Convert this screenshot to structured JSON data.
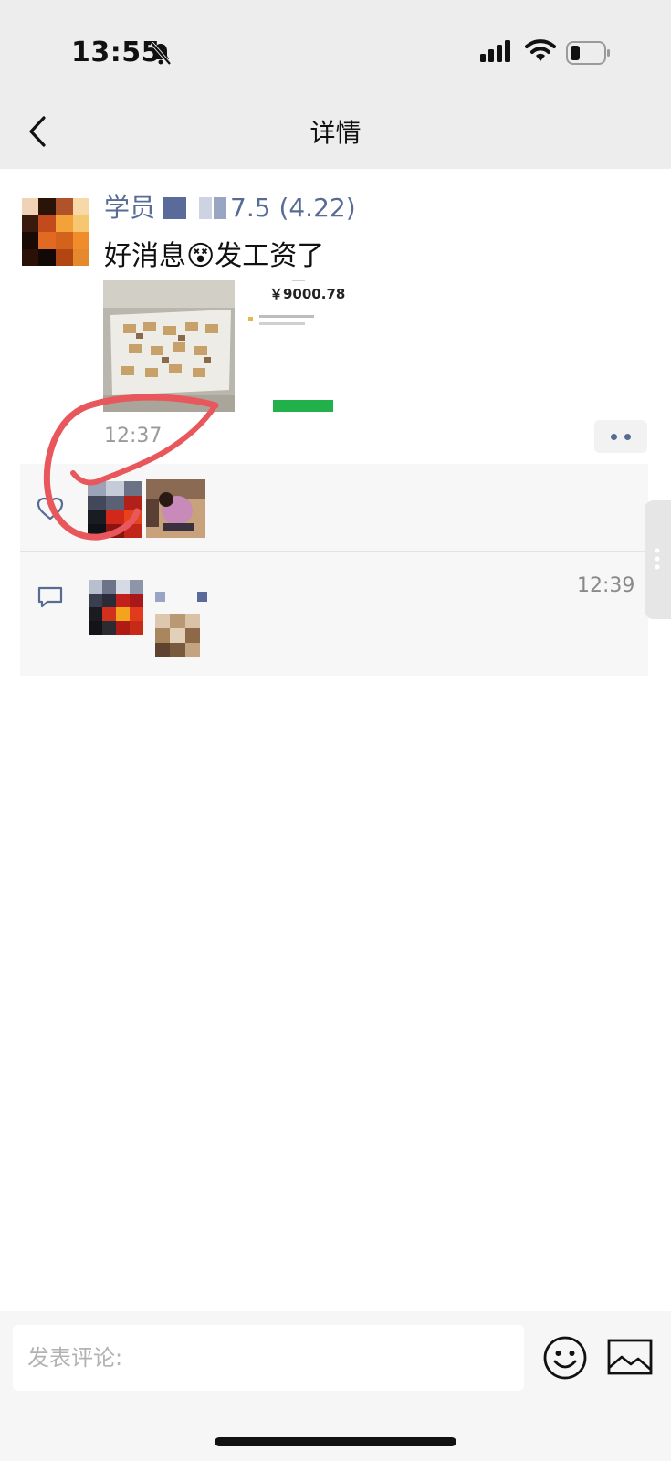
{
  "status_bar": {
    "time": "13:55",
    "icons": [
      "bell-muted-icon",
      "signal-icon",
      "wifi-icon",
      "battery-icon"
    ]
  },
  "nav": {
    "title": "详情",
    "back_icon": "back-chevron-icon"
  },
  "post": {
    "author": "学员",
    "author_suffix": "7.5 (4.22)",
    "text_before": "好消息",
    "emoji": "😵",
    "text_after": "发工资了",
    "images": [
      {
        "name": "photo-cash",
        "description_icon": "cash-photo"
      },
      {
        "name": "photo-payment-screenshot",
        "amount": "￥9000.78"
      }
    ],
    "time": "12:37"
  },
  "likes": {
    "icon": "heart-icon",
    "avatars": [
      "avatar-like-1",
      "avatar-like-2"
    ]
  },
  "comments": [
    {
      "icon": "comment-icon",
      "time": "12:39"
    }
  ],
  "composer": {
    "placeholder": "发表评论:",
    "emoji_icon": "emoji-icon",
    "image_icon": "image-icon"
  },
  "colors": {
    "link_blue": "#576b95",
    "nav_bg": "#ededed",
    "annotation_red": "#e8575c"
  }
}
